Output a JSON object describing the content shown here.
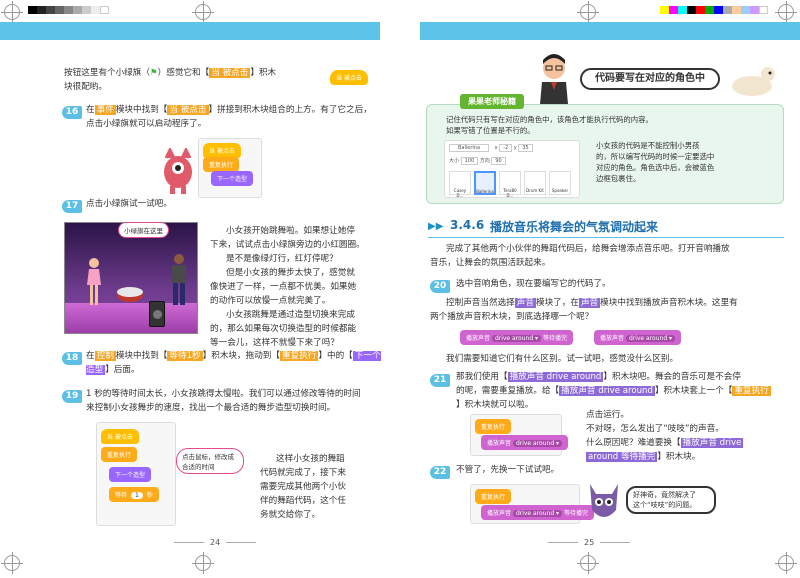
{
  "left_page": {
    "intro": [
      "按钮这里有个小绿旗（",
      "）感觉它和【",
      "】积木",
      "块很配哟。"
    ],
    "intro_block": "当 被点击",
    "steps": [
      {
        "num": "16",
        "text": [
          "在",
          "事件",
          "模块中找到【",
          "当 被点击",
          "】拼接到积木块组合的上方。有了它之后，",
          "点击小绿旗就可以启动程序了。"
        ]
      },
      {
        "num": "17",
        "text": [
          "点击小绿旗试一试吧。"
        ]
      },
      {
        "num": "18",
        "text": [
          "在",
          "控制",
          "模块中找到【",
          "等待1秒",
          "】积木块，拖动到【",
          "重复执行",
          "】中的【",
          "下一个造型",
          "】后面。"
        ]
      },
      {
        "num": "19",
        "text": [
          "1 秒的等待时间太长，小女孩跳得太慢啦。我们可以通过修改等待的时间",
          "来控制小女孩舞步的速度，找出一个最合适的舞步造型切换时间。"
        ]
      }
    ],
    "step16_blocks": [
      "当 被点击",
      "重复执行",
      "下一个造型"
    ],
    "stage_callout": "小绿旗在这里",
    "para17": [
      "小女孩开始跳舞啦。如果想让她停",
      "下来，试试点击小绿旗旁边的小红圆圈。",
      "是不是像绿灯行，红灯停呢？",
      "但是小女孩的舞步太快了，感觉就",
      "像快进了一样，一点都不优美。如果她",
      "的动作可以放慢一点就完美了。",
      "小女孩跳舞是通过造型切换来完成",
      "的，那么如果每次切换造型的时候都能",
      "等一会儿，这样不就慢下来了吗？"
    ],
    "step19_blocks": [
      "当 被点击",
      "重复执行",
      "下一个造型",
      "等待",
      "1",
      "秒"
    ],
    "step19_callout": [
      "点击鼠标，修改成",
      "合适的时间"
    ],
    "para19": [
      "这样小女孩的舞蹈",
      "代码就完成了，接下来",
      "需要完成其他两个小伙",
      "伴的舞蹈代码，这个任",
      "务就交给你了。"
    ],
    "page_number": "24"
  },
  "right_page": {
    "bubble": "代码要写在对应的角色中",
    "teacher_tag": "果果老师秘籍",
    "teacher_text": [
      "记住代码只有写在对应的角色中，该角色才能执行代码的内容。",
      "如果写错了位置是不行的。"
    ],
    "teacher_side": [
      "小女孩的代码是不能控制小男孩",
      "的，所以编写代码的时候一定要选中",
      "对应的角色。角色选中后，会被蓝色",
      "边框包裹住。"
    ],
    "sprite_panel": {
      "sprite_name": "Ballerina",
      "x_label": "x",
      "x_val": "-2",
      "y_label": "y",
      "y_val": "35",
      "size_label": "大小",
      "size_val": "100",
      "dir_label": "方向",
      "dir_val": "90",
      "sprites": [
        "Casey D...",
        "Ballerina",
        "Tera80 D...",
        "Drum Kit",
        "Speaker"
      ]
    },
    "section_num": "3.4.6",
    "section_title": "播放音乐将舞会的气氛调动起来",
    "section_intro": [
      "完成了其他两个小伙伴的舞蹈代码后，给舞会增添点音乐吧。打开音响播放",
      "音乐，让舞会的氛围活跃起来。"
    ],
    "steps": [
      {
        "num": "20",
        "text": [
          "选中音响角色，现在要编写它的代码了。"
        ]
      },
      {
        "num": "21",
        "text": [
          "那我们使用【",
          "播放声音 drive around",
          "】积木块吧。舞会的音乐可是不会停",
          "的呢，需要重复播放。给【",
          "播放声音 drive around",
          "】积木块套上一个【",
          "重复执行",
          "】积木块就可以啦。"
        ]
      },
      {
        "num": "22",
        "text": [
          "不管了，先换一下试试吧。"
        ]
      }
    ],
    "para20": [
      "控制声音当然选择",
      "声音",
      "模块了，在",
      "声音",
      "模块中找到播放声音积木块。这里有",
      "两个播放声音积木块，到底选择哪一个呢？"
    ],
    "sound_blocks": [
      "播放声音",
      "drive around ▾",
      "等待播完"
    ],
    "sound_block2": [
      "播放声音",
      "drive around ▾"
    ],
    "para20b": "我们需要知道它们有什么区别。试一试吧，感觉没什么区别。",
    "step21_blocks": [
      "重复执行",
      "播放声音",
      "drive around ▾"
    ],
    "para21": [
      "点击运行。",
      "不对呀，怎么发出了“吱吱”的声音。",
      "什么原因呢？难道要换【",
      "播放声音 drive",
      "around 等待播完",
      "】积木块。"
    ],
    "step22_blocks": [
      "重复执行",
      "播放声音",
      "drive around ▾",
      "等待播完"
    ],
    "monster_speech": [
      "好神奇，竟然解决了",
      "这个“吱吱”的问题。"
    ],
    "page_number": "25"
  },
  "colors": {
    "accent": "#5ec3e8",
    "event": "#ffbf00",
    "control": "#ffab19",
    "sound": "#cf63cf",
    "looks": "#9966ff"
  }
}
